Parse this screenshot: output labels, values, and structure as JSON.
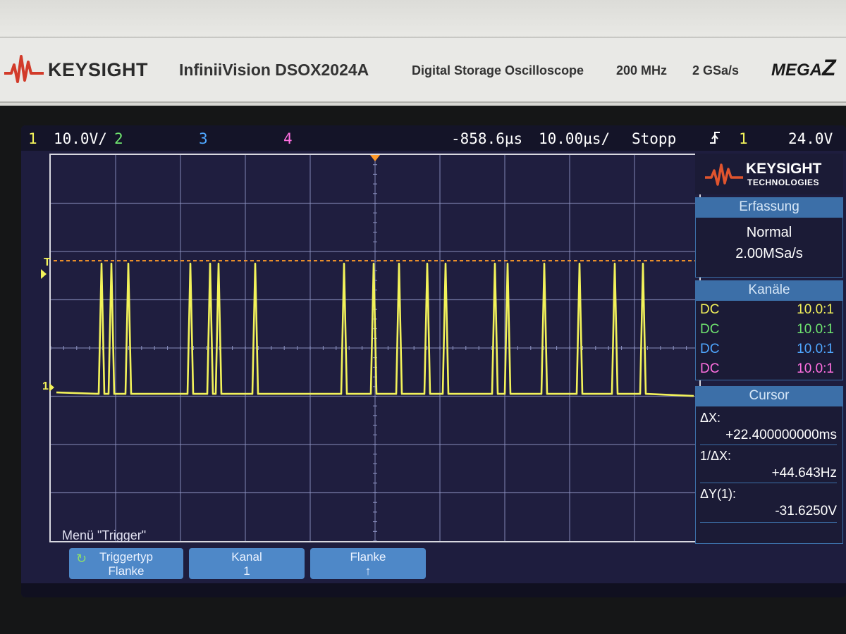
{
  "bezel": {
    "brand": "KEYSIGHT",
    "model": "InfiniiVision DSOX2024A",
    "description": "Digital Storage Oscilloscope",
    "bandwidth": "200 MHz",
    "sample_rate": "2 GSa/s",
    "megazoom": "MEGA",
    "megazoom_mark": "Z"
  },
  "status": {
    "ch1_num": "1",
    "ch1_scale": "10.0V/",
    "ch2_num": "2",
    "ch3_num": "3",
    "ch4_num": "4",
    "time_delay": "-858.6µs",
    "time_scale": "10.00µs/",
    "run_state": "Stopp",
    "trigger_icon": "trigger-edge-icon",
    "trigger_source": "1",
    "trigger_level": "24.0V"
  },
  "markers": {
    "trigger_level_marker": "T",
    "ground_marker": "1"
  },
  "panel": {
    "brand_line1": "KEYSIGHT",
    "brand_line2": "TECHNOLOGIES",
    "acq_title": "Erfassung",
    "acq_mode": "Normal",
    "acq_rate": "2.00MSa/s",
    "channels_title": "Kanäle",
    "channels": [
      {
        "coupling": "DC",
        "atten": "10.0:1",
        "color": "#f2f25a"
      },
      {
        "coupling": "DC",
        "atten": "10.0:1",
        "color": "#6fe46f"
      },
      {
        "coupling": "DC",
        "atten": "10.0:1",
        "color": "#4fa7ff"
      },
      {
        "coupling": "DC",
        "atten": "10.0:1",
        "color": "#ff6fe0"
      }
    ],
    "cursor_title": "Cursor",
    "dx_label": "ΔX:",
    "dx_value": "+22.400000000ms",
    "inv_dx_label": "1/ΔX:",
    "inv_dx_value": "+44.643Hz",
    "dy_label": "ΔY(1):",
    "dy_value": "-31.6250V"
  },
  "menu": {
    "title": "Menü \"Trigger\"",
    "softkeys": [
      {
        "label": "Triggertyp",
        "value": "Flanke"
      },
      {
        "label": "Kanal",
        "value": "1"
      },
      {
        "label": "Flanke",
        "value": "↑"
      }
    ]
  },
  "colors": {
    "ch1": "#f2f25a",
    "ch2": "#6fe46f",
    "ch3": "#4fa7ff",
    "ch4": "#ff6fe0",
    "cursor_line": "#ff9a2a",
    "grid": "#8e94c4",
    "screen_bg": "#1f1e3f",
    "panel_head": "#3c6fa8"
  },
  "waveform": {
    "channel": 1,
    "high_level_div": 1.75,
    "low_level_div": -0.95,
    "pulse_pairs": 18
  }
}
